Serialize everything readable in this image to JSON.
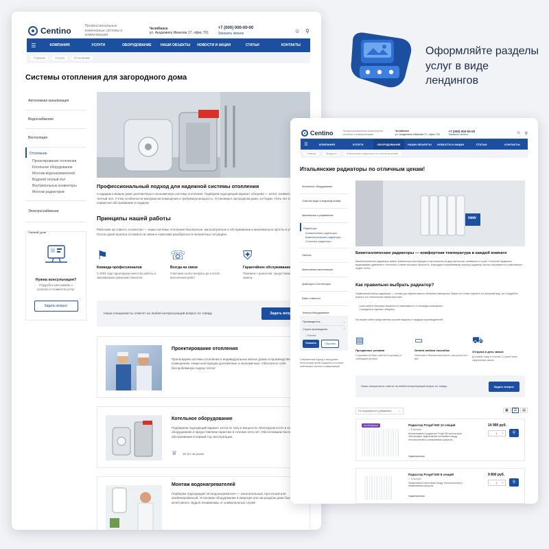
{
  "promo": {
    "text": "Оформляйте разделы услуг в виде лендингов"
  },
  "back": {
    "logo": "Centino",
    "tagline": "Профессиональные инженерные системы и коммуникации",
    "city": "Челябинск",
    "address": "ул. Академика Иванова 17, офис 701",
    "phone": "+7 (000) 000-00-00",
    "callback": "Заказать звонок",
    "nav": [
      "КОМПАНИЯ",
      "УСЛУГИ",
      "ОБОРУДОВАНИЕ",
      "НАШИ ОБЪЕКТЫ",
      "НОВОСТИ И АКЦИИ",
      "СТАТЬИ",
      "КОНТАКТЫ"
    ],
    "crumbs": [
      "Главная",
      "Услуги",
      "Отопление"
    ],
    "title": "Системы отопления для загородного дома",
    "sidebar": [
      "Автономная канализация",
      "Водоснабжение",
      "Вентиляция",
      "Отопление",
      "Электроснабжение",
      "Умный дом"
    ],
    "subs": [
      "Проектирование отопления",
      "Котельное оборудование",
      "Монтаж водонагревателей",
      "Водяной теплый пол",
      "Внутрипольные конвекторы",
      "Монтаж радиаторов"
    ],
    "consult": {
      "title": "Нужна консультация?",
      "text": "Подробно расскажем о услугах и стоимости услуг",
      "button": "Задать вопрос"
    },
    "approach_title": "Профессиональный подход для надежной системы отопления",
    "approach_text": "Создадим в вашем доме долговечную и экономичную систему отопления. Подберем подходящий вариант обогрева — котел, конвектор или теплый пол. Учтем особенности материалов помещения и требуемую мощность. Установим в загородном доме, коттедже. Пять лет гарантии и сервисное обслуживание в подарок!",
    "principles_title": "Принципы нашей работы",
    "principles_text": "Работаем на совесть и качество — наши системы отопления безопасные, малозатратные в обслуживании и максимально просты в управлении. После сдачи проекта остаемся на связи и помогаем разобраться в непонятных ситуациях.",
    "features": [
      {
        "title": "Команда профессионалов",
        "text": "С 2004 года гарантируем качество работы и завоевываем признание клиентов"
      },
      {
        "title": "Всегда на связи",
        "text": "Отвечаем на все вопросы до и после выполнения работ"
      },
      {
        "title": "Гарантийное обслуживание",
        "text": "Поможем с ремонтом, предоставим аппарат на замену"
      }
    ],
    "ask_text": "Наши специалисты ответят на любой интересующий вопрос по товару",
    "ask_button": "Задать вопрос",
    "services": [
      {
        "title": "Проектирование отопления",
        "text": "Проектируем системы отопления в индивидуальных жилых домах и производственных помещениях. Наши конструкции долговечные и экономичные. Обеспечьте себе беспроблемную подачу тепла!"
      },
      {
        "title": "Котельное оборудование",
        "text": "Подбираем подходящий вариант котла по типу и мощности. Монтируем котел и котельное оборудование и предоставляем гарантию в течение пяти лет. Обеспечиваем бесплатное обслуживание в первый год эксплуатации.",
        "badge": "15 лет на рынке"
      },
      {
        "title": "Монтаж водонагревателей",
        "text": "Подберем подходящий тип водонагревателя — накопительный, проточный или комбинированный. Установим оборудование в квартире или загородном доме быстро и качественно. Будьте независимы от коммунальных служб!"
      }
    ]
  },
  "front": {
    "logo": "Centino",
    "tagline": "Профессиональные инженерные системы и коммуникации",
    "city": "Челябинск",
    "address": "ул. Академика Иванова 17, офис 701",
    "phone": "+7 (000) 000-00-00",
    "callback": "Заказать звонок",
    "nav": [
      "КОМПАНИЯ",
      "УСЛУГИ",
      "ОБОРУДОВАНИЕ",
      "НАШИ ОБЪЕКТЫ",
      "НОВОСТИ И АКЦИИ",
      "СТАТЬИ",
      "КОНТАКТЫ"
    ],
    "crumbs": [
      "Главная",
      "Продукты",
      "Итальянские радиаторы по отличным ценам!"
    ],
    "title": "Итальянские радиаторы по отличным ценам!",
    "sidebar": [
      "Котельное оборудование",
      "Очистка воды и водоподготовка",
      "Автоматика и управление",
      "Радиаторы",
      "Насосы",
      "Автономная канализация",
      "Арматура и коллекторы",
      "Баки и емкости",
      "Электрооборудование"
    ],
    "subs": [
      "Алюминиевые радиаторы",
      "Биметаллические радиаторы",
      "Стальные радиаторы"
    ],
    "filters": {
      "maker": "Производитель",
      "country": "Страна производства",
      "country_value": "Италия",
      "show": "Показать",
      "reset": "Сбросить"
    },
    "side_note": "Современный подход к передовым технологиям путем создания и поставки инженерных систем и коммуникаций",
    "hero_badge": "new",
    "section_title": "Биметаллические радиаторы — комфортная температура в каждой комнате",
    "section_text": "Биметаллические радиаторы имеют уникальную конструкцию и изготовлены из двух металлов: алюминия и стали. Стальной сердечник выдерживает давление в теплосети и имеет высокую прочность. Благодаря алюминиевому корпусу радиатор быстро нагревается и равномерно отдает тепло.",
    "choose_title": "Как правильно выбрать радиатор?",
    "choose_text": "Правильный выбор радиатора — основа для эффективного обогрева помещения. Важно не только оценить его внешний вид, но и подробно изучить его технические характеристики.",
    "bullets": [
      "рассчитать тепловую мощность в зависимости от площади помещения;",
      "определить нужные габариты."
    ],
    "choose_note": "На нашем сайте представлены лучшие модели от ведущих производителей.",
    "features": [
      {
        "title": "Прозрачные условия",
        "text": "Сохраняем на букет работы по договору и соблюдаем условия"
      },
      {
        "title": "Оплата любым способом",
        "text": "Наличные и безналичный расчет, рассрочка на 6 мес."
      },
      {
        "title": "Отгрузка в день заказа",
        "text": "Доставим товар в течение 1-2 дней после оформления заказа"
      }
    ],
    "ask_text": "Наши специалисты ответят на любой интересующий вопрос по товару",
    "ask_button": "Задать вопрос",
    "sort": "По популярности (убывание)",
    "products": [
      {
        "badge": "РАСПРОДАЖА",
        "name": "Радиатор Progef 500 12 секций",
        "stock": "В наличии",
        "desc": "Использование в радиаторе Progef 500 коллекторов обеспечивает эффективный теплообмен между теплоносителем и алюминиевым корпусом.",
        "more": "Характеристики",
        "price": "14 990 руб.",
        "qty": "1"
      },
      {
        "badge": "",
        "name": "Радиатор Progef 500 8 секций",
        "stock": "В наличии",
        "desc": "Эффективный теплообмен между теплоносителем и алюминиевым корпусом.",
        "more": "Характеристики",
        "price": "9 800 руб.",
        "qty": "1"
      }
    ]
  }
}
